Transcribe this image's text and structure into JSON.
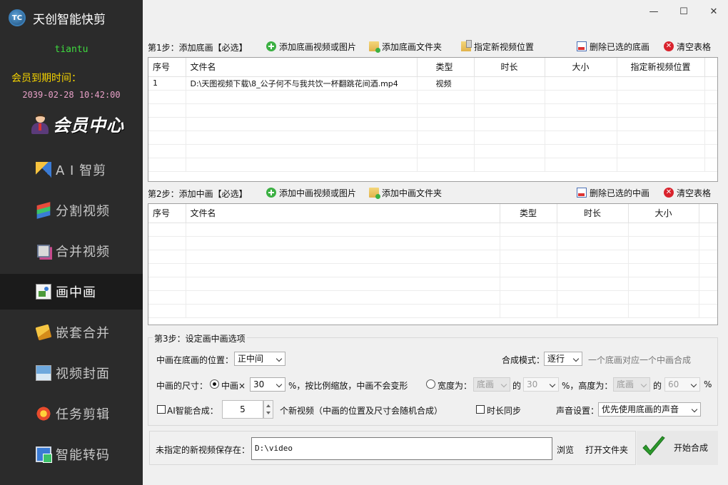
{
  "app": {
    "title": "天创智能快剪",
    "logo_text": "TC",
    "username": "tiantu",
    "expiry_label": "会员到期时间：",
    "expiry_date": "2039-02-28 10:42:00",
    "member_center": "会员中心"
  },
  "window": {
    "minimize": "—",
    "maximize": "☐",
    "close": "✕"
  },
  "nav": [
    {
      "label": "A I 智剪",
      "icon": "ai-wand-icon",
      "active": false
    },
    {
      "label": "分割视频",
      "icon": "split-video-icon",
      "active": false
    },
    {
      "label": "合并视频",
      "icon": "merge-video-icon",
      "active": false
    },
    {
      "label": "画中画",
      "icon": "picture-in-picture-icon",
      "active": true
    },
    {
      "label": "嵌套合并",
      "icon": "nest-merge-icon",
      "active": false
    },
    {
      "label": "视频封面",
      "icon": "video-cover-icon",
      "active": false
    },
    {
      "label": "任务剪辑",
      "icon": "task-edit-icon",
      "active": false
    },
    {
      "label": "智能转码",
      "icon": "smart-transcode-icon",
      "active": false
    }
  ],
  "step1": {
    "label": "第1步：添加底画【必选】",
    "add_files": "添加底画视频或图片",
    "add_folder": "添加底画文件夹",
    "set_location": "指定新视频位置",
    "delete_selected": "删除已选的底画",
    "clear_table": "清空表格",
    "columns": [
      "序号",
      "文件名",
      "类型",
      "时长",
      "大小",
      "指定新视频位置"
    ],
    "rows": [
      [
        "1",
        "D:\\天图视频下载\\8_公子何不与我共饮一杯翻跳花间酒.mp4",
        "视频",
        "",
        "",
        ""
      ]
    ]
  },
  "step2": {
    "label": "第2步：添加中画【必选】",
    "add_files": "添加中画视频或图片",
    "add_folder": "添加中画文件夹",
    "delete_selected": "删除已选的中画",
    "clear_table": "清空表格",
    "columns": [
      "序号",
      "文件名",
      "类型",
      "时长",
      "大小"
    ],
    "rows": []
  },
  "step3": {
    "title": "第3步：设定画中画选项",
    "position_label": "中画在底画的位置：",
    "position_value": "正中间",
    "mode_label": "合成模式：",
    "mode_value": "逐行",
    "mode_hint": "一个底画对应一个中画合成",
    "size_label": "中画的尺寸：",
    "size_option_a": "中画×",
    "size_scale_value": "30",
    "size_option_a_hint": "%，按比例缩放，中画不会变形",
    "width_label": "宽度为：",
    "width_ref": "底画",
    "width_of": "的",
    "width_value": "30",
    "height_label": "%，高度为：",
    "height_ref": "底画",
    "height_of": "的",
    "height_value": "60",
    "percent": "%",
    "ai_label": "AI智能合成：",
    "ai_count": "5",
    "ai_hint": "个新视频（中画的位置及尺寸会随机合成）",
    "sync_label": "时长同步",
    "sound_label": "声音设置：",
    "sound_value": "优先使用底画的声音"
  },
  "save": {
    "label": "未指定的新视频保存在：",
    "path": "D:\\video",
    "browse": "浏览",
    "open_folder": "打开文件夹",
    "start": "开始合成"
  }
}
